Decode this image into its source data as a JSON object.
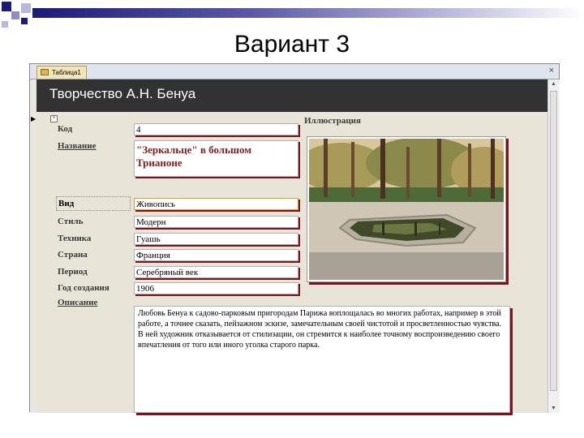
{
  "slide": {
    "title": "Вариант 3",
    "accent_colors": [
      "#1c1c78",
      "#5a5aa8",
      "#b8b8dc"
    ]
  },
  "window": {
    "tab_label": "Таблица1",
    "close_icon": "close-icon"
  },
  "form": {
    "title": "Творчество А.Н. Бенуа",
    "fields": {
      "code": {
        "label": "Код",
        "value": "4"
      },
      "name": {
        "label": "Название",
        "value": "\"Зеркальце\" в большом Трианоне"
      },
      "kind": {
        "label": "Вид",
        "value": "Живопись"
      },
      "style": {
        "label": "Стиль",
        "value": "Модерн"
      },
      "technique": {
        "label": "Техника",
        "value": "Гуашь"
      },
      "country": {
        "label": "Страна",
        "value": "Франция"
      },
      "period": {
        "label": "Период",
        "value": "Серебряный век"
      },
      "year": {
        "label": "Год создания",
        "value": "1906"
      },
      "description": {
        "label": "Описание",
        "value": "Любовь Бенуа к садово-парковым пригородам Парижа воплощалась во многих работах, например в этой работе, а точнее сказать, пейзажном эскизе, замечательным своей чистотой и просветленностью чувства. В ней художник отказывается от стилизации, он стремится к наиболее точному воспроизведению своего впечатления от того или иного уголка старого парка."
      }
    },
    "illustration": {
      "label": "Иллюстрация"
    }
  },
  "colors": {
    "header_bg": "#323232",
    "field_shadow": "#7a1520",
    "name_text": "#8b1a1a"
  }
}
